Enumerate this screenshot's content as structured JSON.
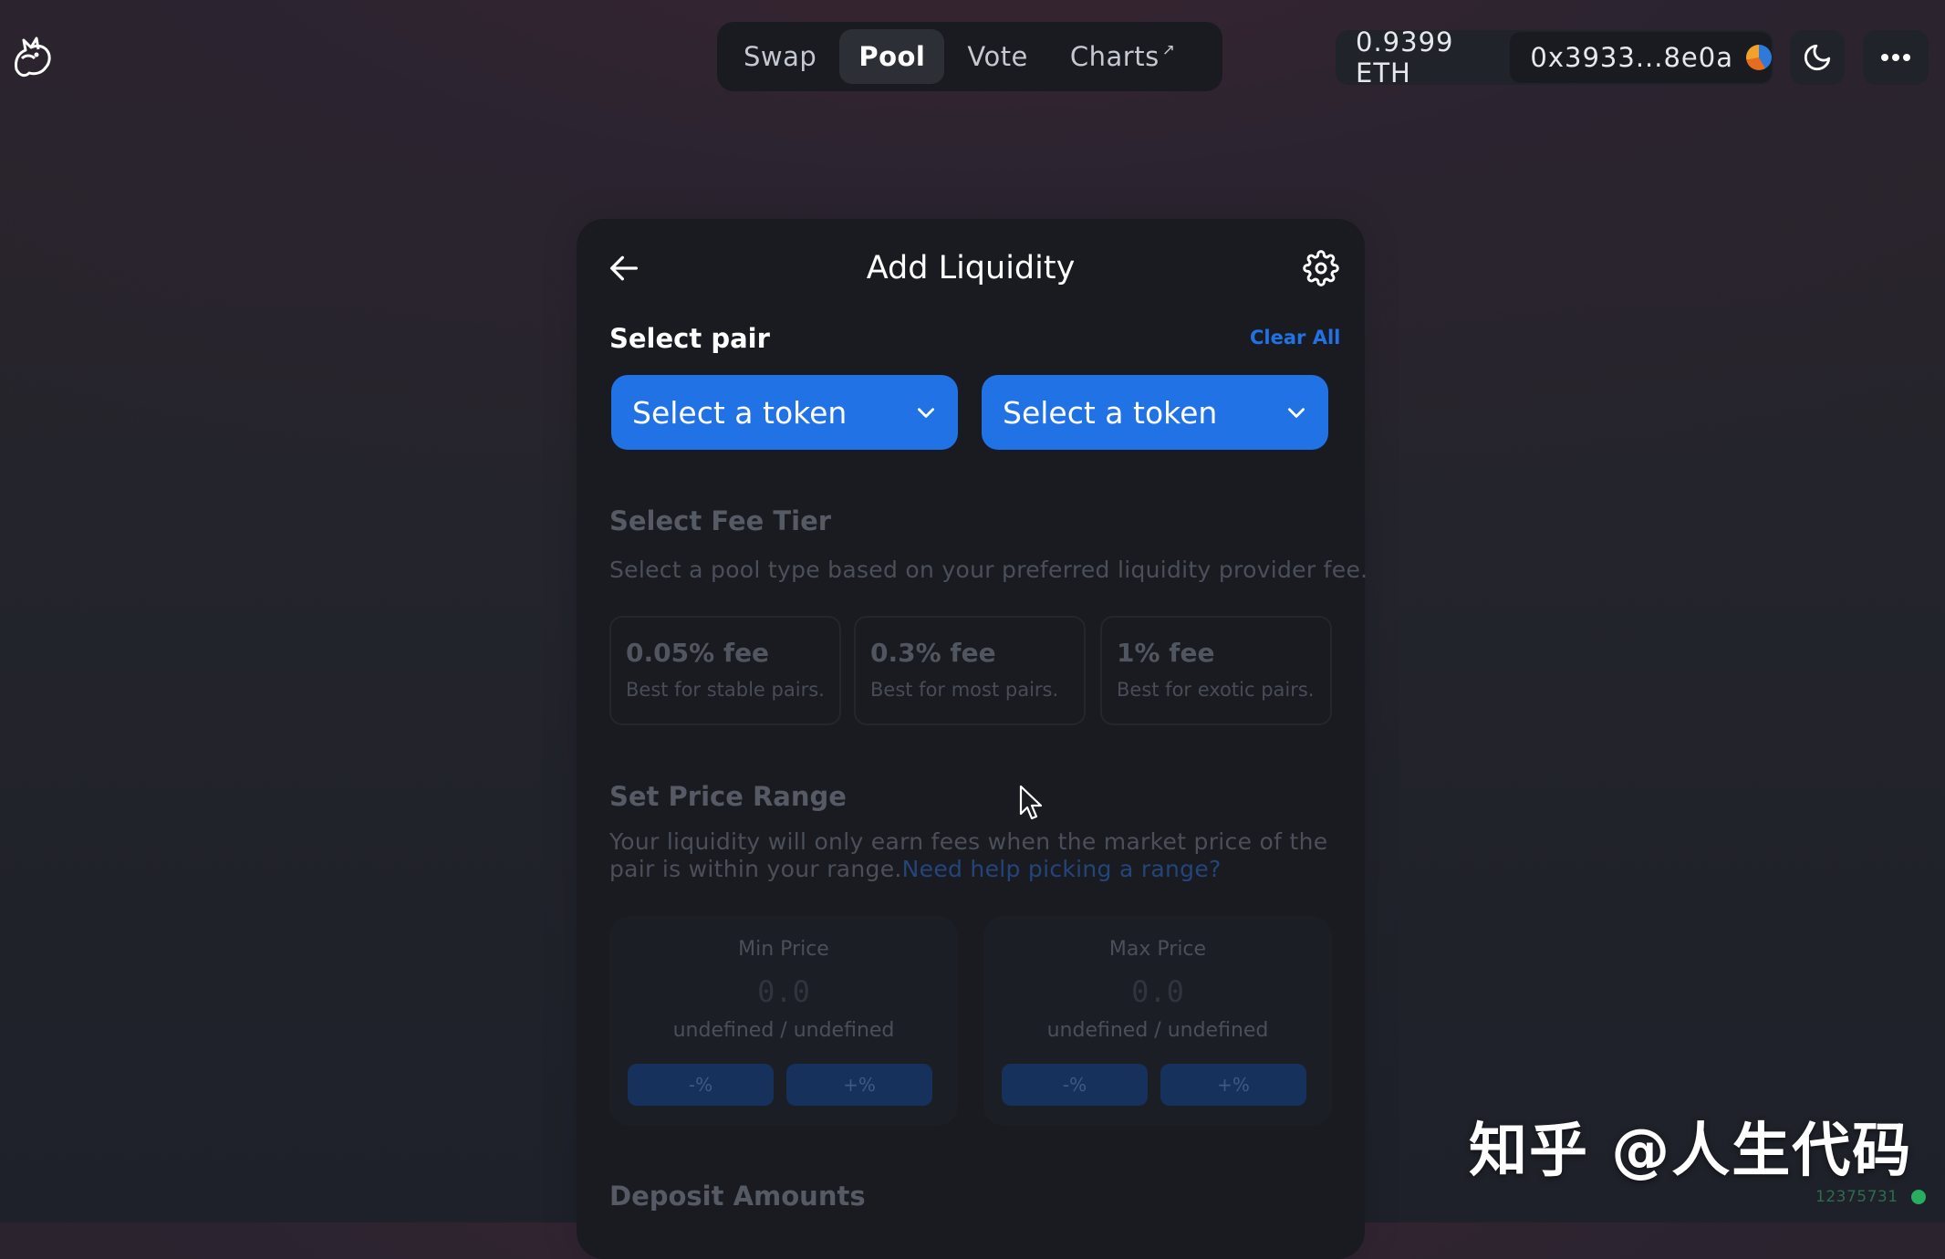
{
  "nav": {
    "items": [
      {
        "label": "Swap",
        "active": false
      },
      {
        "label": "Pool",
        "active": true
      },
      {
        "label": "Vote",
        "active": false
      },
      {
        "label": "Charts",
        "active": false,
        "external": true
      }
    ],
    "external_glyph": "↗"
  },
  "account": {
    "balance": "0.9399 ETH",
    "address": "0x3933...8e0a"
  },
  "icons": {
    "logo": "uniswap-unicorn-icon",
    "theme": "moon-icon",
    "menu": "more-horizontal-icon",
    "back": "arrow-left-icon",
    "settings": "gear-icon",
    "dropdown": "chevron-down-icon"
  },
  "card": {
    "title": "Add Liquidity",
    "select_pair_label": "Select pair",
    "clear_all": "Clear All",
    "token_a_label": "Select a token",
    "token_b_label": "Select a token"
  },
  "fee_tier": {
    "heading": "Select Fee Tier",
    "description": "Select a pool type based on your preferred liquidity provider fee.",
    "options": [
      {
        "title": "0.05% fee",
        "subtitle": "Best for stable pairs."
      },
      {
        "title": "0.3% fee",
        "subtitle": "Best for most pairs."
      },
      {
        "title": "1% fee",
        "subtitle": "Best for exotic pairs."
      }
    ]
  },
  "price_range": {
    "heading": "Set Price Range",
    "description": "Your liquidity will only earn fees when the market price of the pair is within your range.",
    "help_link": "Need help picking a range?",
    "min": {
      "label": "Min Price",
      "value_placeholder": "0.0",
      "unit": "undefined / undefined",
      "decrement": "-%",
      "increment": "+%"
    },
    "max": {
      "label": "Max Price",
      "value_placeholder": "0.0",
      "unit": "undefined / undefined",
      "decrement": "-%",
      "increment": "+%"
    }
  },
  "deposit": {
    "heading": "Deposit Amounts"
  },
  "watermark": "知乎 @人生代码",
  "status": {
    "block_number": "12375731",
    "dot_color": "#27ae60"
  },
  "colors": {
    "accent": "#2172e5",
    "card_bg": "#191b21"
  }
}
